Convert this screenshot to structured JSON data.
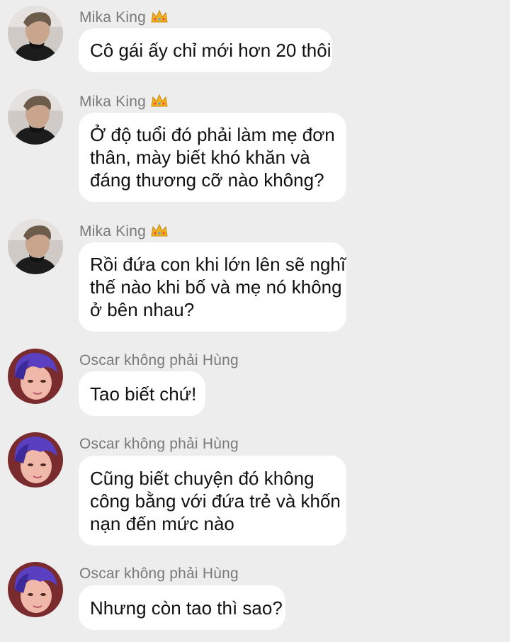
{
  "messages": [
    {
      "sender": "Mika King",
      "crown": true,
      "avatar": "man-avatar",
      "lines": [
        "Cô gái ấy chỉ mới hơn 20 thôi"
      ]
    },
    {
      "sender": "Mika King",
      "crown": true,
      "avatar": "man-avatar",
      "lines": [
        "Ở độ tuổi đó phải làm mẹ đơn",
        "thân, mày biết khó khăn và",
        "đáng thương cỡ nào không?"
      ]
    },
    {
      "sender": "Mika King",
      "crown": true,
      "avatar": "man-avatar",
      "lines": [
        "Rồi đứa con khi lớn lên sẽ nghĩ",
        "thế nào khi bố và mẹ nó không",
        "ở bên nhau?"
      ]
    },
    {
      "sender": "Oscar không phải Hùng",
      "crown": false,
      "avatar": "purple-hair-avatar",
      "lines": [
        "Tao biết chứ!"
      ]
    },
    {
      "sender": "Oscar không phải Hùng",
      "crown": false,
      "avatar": "purple-hair-avatar",
      "lines": [
        "Cũng biết chuyện đó không",
        "công bằng với đứa trẻ và khốn",
        "nạn đến mức nào"
      ]
    },
    {
      "sender": "Oscar không phải Hùng",
      "crown": false,
      "avatar": "purple-hair-avatar",
      "lines": [
        "Nhưng còn tao thì sao?"
      ]
    }
  ],
  "colors": {
    "background": "#ededed",
    "bubble": "#ffffff",
    "sender_text": "#7a7a7a",
    "message_text": "#111111",
    "crown": "#f2b21c"
  }
}
